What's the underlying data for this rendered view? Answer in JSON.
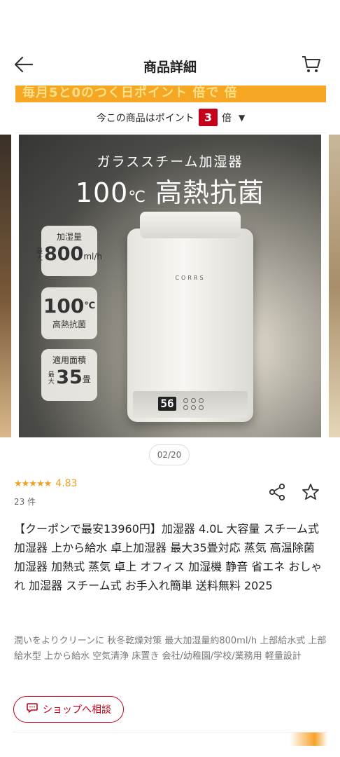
{
  "header": {
    "title": "商品詳細",
    "back_icon": "back-arrow-icon",
    "cart_icon": "cart-icon"
  },
  "promo": {
    "banner_text": "毎月5と0のつく日ポイント 倍で 倍"
  },
  "points": {
    "prefix": "今この商品はポイント",
    "multiplier": "3",
    "suffix": "倍"
  },
  "slide": {
    "subtitle": "ガラススチーム加湿器",
    "title_num": "100",
    "title_unit": "℃",
    "title_text": "高熱抗菌",
    "brand": "CORRS",
    "display_value": "56",
    "features": [
      {
        "label": "加湿量",
        "small": "最大",
        "value": "800",
        "unit": "ml/h"
      },
      {
        "value": "100",
        "unit": "℃",
        "label": "高熱抗菌"
      },
      {
        "label": "適用面積",
        "small": "最大",
        "value": "35",
        "unit": "畳"
      }
    ]
  },
  "pager": {
    "text": "02/20",
    "current": 2,
    "total": 20
  },
  "rating": {
    "value": "4.83",
    "stars": 5,
    "count": "23 件"
  },
  "product": {
    "title": "【クーポンで最安13960円】加湿器 4.0L 大容量 スチーム式加湿器 上から給水 卓上加湿器 最大35畳対応 蒸気 高温除菌 加湿器 加熱式 蒸気 卓上 オフィス 加湿機 静音 省エネ おしゃれ 加湿器 スチーム式 お手入れ簡単 送料無料 2025",
    "description": "潤いをよりクリーンに 秋冬乾燥対策 最大加湿量約800ml/h 上部給水式 上部給水型 上から給水 空気清浄 床置き 会社/幼稚園/学校/業務用 軽量設計"
  },
  "actions": {
    "consult_label": "ショップへ相談",
    "share_icon": "share-icon",
    "favorite_icon": "star-outline-icon"
  },
  "colors": {
    "accent": "#c4001a",
    "rating": "#f0a020",
    "promo": "#f5a623"
  }
}
